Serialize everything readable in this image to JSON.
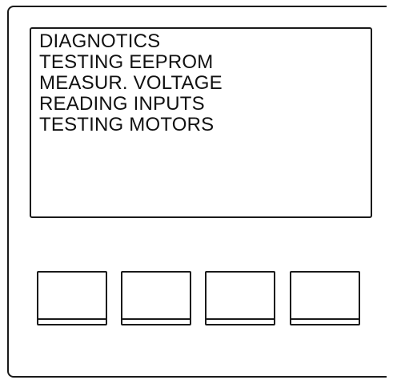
{
  "display": {
    "lines": [
      "DIAGNOTICS",
      "TESTING EEPROM",
      "MEASUR. VOLTAGE",
      "READING INPUTS",
      "TESTING MOTORS"
    ]
  },
  "colors": {
    "outline": "#1a1a1a",
    "text": "#111111",
    "background": "#ffffff"
  }
}
